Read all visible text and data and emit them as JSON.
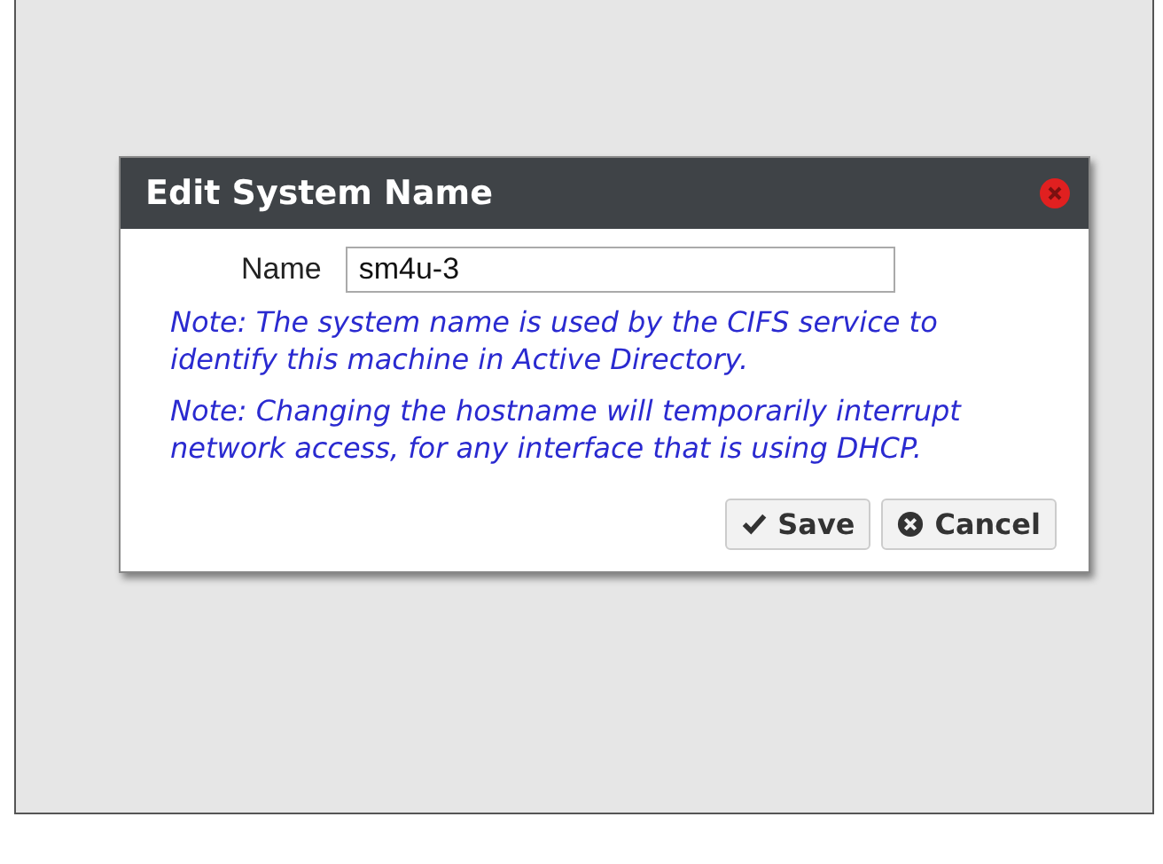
{
  "dialog": {
    "title": "Edit System Name",
    "field": {
      "label": "Name",
      "value": "sm4u-3"
    },
    "notes": [
      "Note: The system name is used by the CIFS service to identify this machine in Active Directory.",
      "Note: Changing the hostname will temporarily interrupt network access, for any interface that is using DHCP."
    ],
    "buttons": [
      {
        "kind": "save",
        "label": "Save"
      },
      {
        "kind": "cancel",
        "label": "Cancel"
      }
    ]
  }
}
